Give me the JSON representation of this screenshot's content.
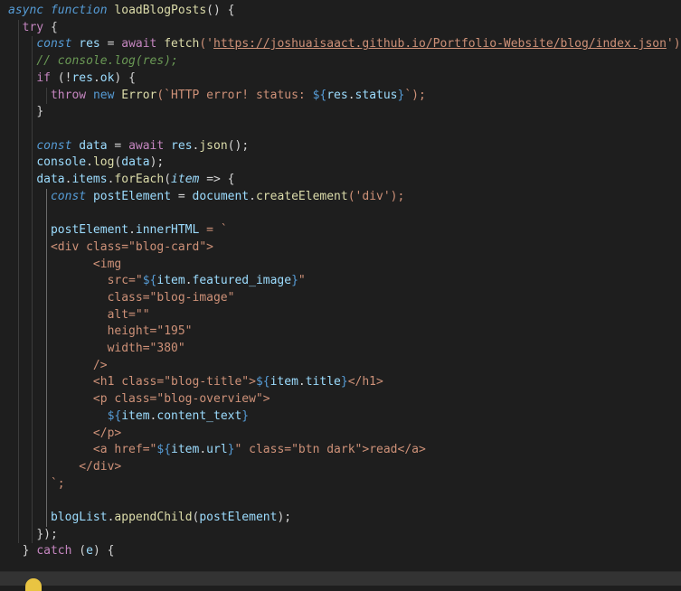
{
  "colors": {
    "background": "#1e1e1e",
    "keyword_italic": "#569cd6",
    "control": "#c586c0",
    "function": "#dcdcaa",
    "variable": "#9cdcfe",
    "string": "#ce9178",
    "comment": "#6a9955",
    "plain": "#d4d4d4"
  },
  "code": {
    "lines": [
      [
        [
          "async ",
          "ki"
        ],
        [
          "function ",
          "ki"
        ],
        [
          "loadBlogPosts",
          "fn"
        ],
        [
          "() {",
          "p"
        ]
      ],
      [
        [
          "  "
        ],
        [
          "try ",
          "ctl"
        ],
        [
          "{",
          "p"
        ]
      ],
      [
        [
          "    "
        ],
        [
          "const ",
          "ki"
        ],
        [
          "res ",
          "var"
        ],
        [
          "= ",
          "p"
        ],
        [
          "await ",
          "ctl"
        ],
        [
          "fetch",
          "fn"
        ],
        [
          "('",
          "str"
        ],
        [
          "https://joshuaisaact.github.io/Portfolio-Website/blog/index.json",
          "url"
        ],
        [
          "');",
          "str"
        ]
      ],
      [
        [
          "    "
        ],
        [
          "// console.log(res);",
          "cmt"
        ]
      ],
      [
        [
          "    "
        ],
        [
          "if ",
          "ctl"
        ],
        [
          "(!",
          "p"
        ],
        [
          "res",
          "var"
        ],
        [
          ".",
          "p"
        ],
        [
          "ok",
          "var"
        ],
        [
          ") {",
          "p"
        ]
      ],
      [
        [
          "      "
        ],
        [
          "throw ",
          "ctl"
        ],
        [
          "new ",
          "ki2"
        ],
        [
          "Error",
          "fn"
        ],
        [
          "(`HTTP error! status: ",
          "str"
        ],
        [
          "${",
          "ki2"
        ],
        [
          "res",
          "var"
        ],
        [
          ".",
          "p"
        ],
        [
          "status",
          "var"
        ],
        [
          "}",
          "ki2"
        ],
        [
          "`);",
          "str"
        ]
      ],
      [
        [
          "    "
        ],
        [
          "}",
          "p"
        ]
      ],
      [
        [
          ""
        ]
      ],
      [
        [
          "    "
        ],
        [
          "const ",
          "ki"
        ],
        [
          "data ",
          "var"
        ],
        [
          "= ",
          "p"
        ],
        [
          "await ",
          "ctl"
        ],
        [
          "res",
          "var"
        ],
        [
          ".",
          "p"
        ],
        [
          "json",
          "fn"
        ],
        [
          "();",
          "p"
        ]
      ],
      [
        [
          "    "
        ],
        [
          "console",
          "var"
        ],
        [
          ".",
          "p"
        ],
        [
          "log",
          "fn"
        ],
        [
          "(",
          "p"
        ],
        [
          "data",
          "var"
        ],
        [
          ");",
          "p"
        ]
      ],
      [
        [
          "    "
        ],
        [
          "data",
          "var"
        ],
        [
          ".",
          "p"
        ],
        [
          "items",
          "var"
        ],
        [
          ".",
          "p"
        ],
        [
          "forEach",
          "fn"
        ],
        [
          "(",
          "p"
        ],
        [
          "item ",
          "ivar"
        ],
        [
          "=> {",
          "p"
        ]
      ],
      [
        [
          "      "
        ],
        [
          "const ",
          "ki"
        ],
        [
          "postElement ",
          "var"
        ],
        [
          "= ",
          "p"
        ],
        [
          "document",
          "var"
        ],
        [
          ".",
          "p"
        ],
        [
          "createElement",
          "fn"
        ],
        [
          "('div');",
          "str"
        ]
      ],
      [
        [
          ""
        ]
      ],
      [
        [
          "      "
        ],
        [
          "postElement",
          "var"
        ],
        [
          ".",
          "p"
        ],
        [
          "innerHTML ",
          "var"
        ],
        [
          "= `",
          "str"
        ]
      ],
      [
        [
          "      "
        ],
        [
          "<div class=\"blog-card\">",
          "str"
        ]
      ],
      [
        [
          "            "
        ],
        [
          "<img",
          "str"
        ]
      ],
      [
        [
          "              "
        ],
        [
          "src=\"",
          "str"
        ],
        [
          "${",
          "ki2"
        ],
        [
          "item",
          "var"
        ],
        [
          ".",
          "p"
        ],
        [
          "featured_image",
          "var"
        ],
        [
          "}",
          "ki2"
        ],
        [
          "\"",
          "str"
        ]
      ],
      [
        [
          "              "
        ],
        [
          "class=\"blog-image\"",
          "str"
        ]
      ],
      [
        [
          "              "
        ],
        [
          "alt=\"\"",
          "str"
        ]
      ],
      [
        [
          "              "
        ],
        [
          "height=\"195\"",
          "str"
        ]
      ],
      [
        [
          "              "
        ],
        [
          "width=\"380\"",
          "str"
        ]
      ],
      [
        [
          "            "
        ],
        [
          "/>",
          "str"
        ]
      ],
      [
        [
          "            "
        ],
        [
          "<h1 class=\"blog-title\">",
          "str"
        ],
        [
          "${",
          "ki2"
        ],
        [
          "item",
          "var"
        ],
        [
          ".",
          "p"
        ],
        [
          "title",
          "var"
        ],
        [
          "}",
          "ki2"
        ],
        [
          "</h1>",
          "str"
        ]
      ],
      [
        [
          "            "
        ],
        [
          "<p class=\"blog-overview\">",
          "str"
        ]
      ],
      [
        [
          "              "
        ],
        [
          "${",
          "ki2"
        ],
        [
          "item",
          "var"
        ],
        [
          ".",
          "p"
        ],
        [
          "content_text",
          "var"
        ],
        [
          "}",
          "ki2"
        ]
      ],
      [
        [
          "            "
        ],
        [
          "</p>",
          "str"
        ]
      ],
      [
        [
          "            "
        ],
        [
          "<a href=\"",
          "str"
        ],
        [
          "${",
          "ki2"
        ],
        [
          "item",
          "var"
        ],
        [
          ".",
          "p"
        ],
        [
          "url",
          "var"
        ],
        [
          "}",
          "ki2"
        ],
        [
          "\" class=\"btn dark\">read</a>",
          "str"
        ]
      ],
      [
        [
          "          "
        ],
        [
          "</div>",
          "str"
        ]
      ],
      [
        [
          "      "
        ],
        [
          "`;",
          "str"
        ]
      ],
      [
        [
          ""
        ]
      ],
      [
        [
          "      "
        ],
        [
          "blogList",
          "var"
        ],
        [
          ".",
          "p"
        ],
        [
          "appendChild",
          "fn"
        ],
        [
          "(",
          "p"
        ],
        [
          "postElement",
          "var"
        ],
        [
          ");",
          "p"
        ]
      ],
      [
        [
          "    "
        ],
        [
          "});",
          "p"
        ]
      ],
      [
        [
          "  "
        ],
        [
          "} ",
          "p"
        ],
        [
          "catch ",
          "ctl"
        ],
        [
          "(",
          "p"
        ],
        [
          "e",
          "var"
        ],
        [
          ") {",
          "p"
        ]
      ]
    ]
  }
}
